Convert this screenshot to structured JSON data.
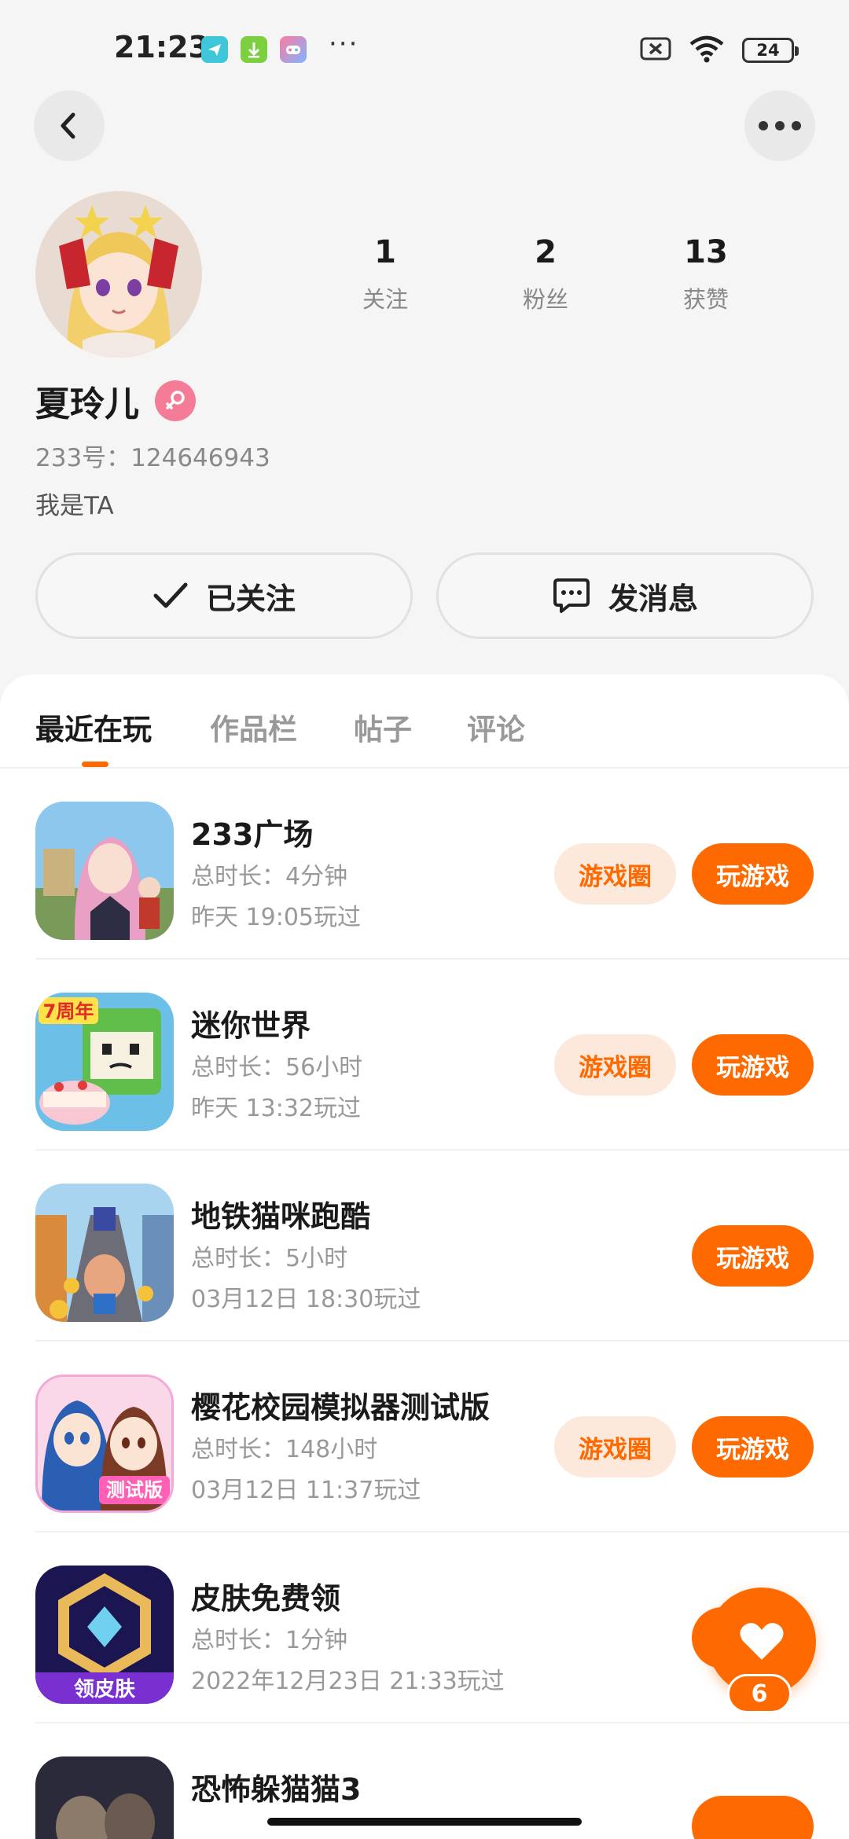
{
  "status_bar": {
    "time": "21:23",
    "more": "···",
    "battery": "24",
    "icons": [
      "telegram-icon",
      "download-icon",
      "game-center-icon",
      "sim-off-icon",
      "wifi-icon",
      "battery-icon"
    ]
  },
  "nav": {
    "back_icon": "chevron-left-icon",
    "more_icon": "more-horizontal-icon"
  },
  "profile": {
    "name": "夏玲儿",
    "gender": "female",
    "uid": "233号：124646943",
    "bio": "我是TA",
    "stats": [
      {
        "value": "1",
        "label": "关注"
      },
      {
        "value": "2",
        "label": "粉丝"
      },
      {
        "value": "13",
        "label": "获赞"
      }
    ]
  },
  "actions": {
    "followed_label": "已关注",
    "message_label": "发消息"
  },
  "tabs": [
    {
      "label": "最近在玩",
      "active": true
    },
    {
      "label": "作品栏",
      "active": false
    },
    {
      "label": "帖子",
      "active": false
    },
    {
      "label": "评论",
      "active": false
    }
  ],
  "games": [
    {
      "title": "233广场",
      "duration": "总时长：4分钟",
      "last_played": "昨天 19:05玩过",
      "has_circle": true,
      "circle_label": "游戏圈",
      "play_label": "玩游戏"
    },
    {
      "title": "迷你世界",
      "duration": "总时长：56小时",
      "last_played": "昨天 13:32玩过",
      "has_circle": true,
      "circle_label": "游戏圈",
      "play_label": "玩游戏"
    },
    {
      "title": "地铁猫咪跑酷",
      "duration": "总时长：5小时",
      "last_played": "03月12日 18:30玩过",
      "has_circle": false,
      "circle_label": "",
      "play_label": "玩游戏"
    },
    {
      "title": "樱花校园模拟器测试版",
      "duration": "总时长：148小时",
      "last_played": "03月12日 11:37玩过",
      "has_circle": true,
      "circle_label": "游戏圈",
      "play_label": "玩游戏"
    },
    {
      "title": "皮肤免费领",
      "duration": "总时长：1分钟",
      "last_played": "2022年12月23日 21:33玩过",
      "has_circle": false,
      "circle_label": "",
      "play_label": "玩游戏"
    },
    {
      "title": "恐怖躲猫猫3",
      "duration": "",
      "last_played": "",
      "has_circle": false,
      "circle_label": "",
      "play_label": ""
    }
  ],
  "game_icon_texts": {
    "mini_world_badge": "7周年",
    "sakura_badge": "测试版",
    "skin_badge": "领皮肤"
  },
  "like_fab": {
    "count": "6",
    "icon": "heart-icon"
  },
  "colors": {
    "accent": "#ff6a00",
    "accent_light": "#fde8dc",
    "background": "#f5f5f5",
    "card": "#ffffff",
    "gender_female": "#f47c96"
  }
}
